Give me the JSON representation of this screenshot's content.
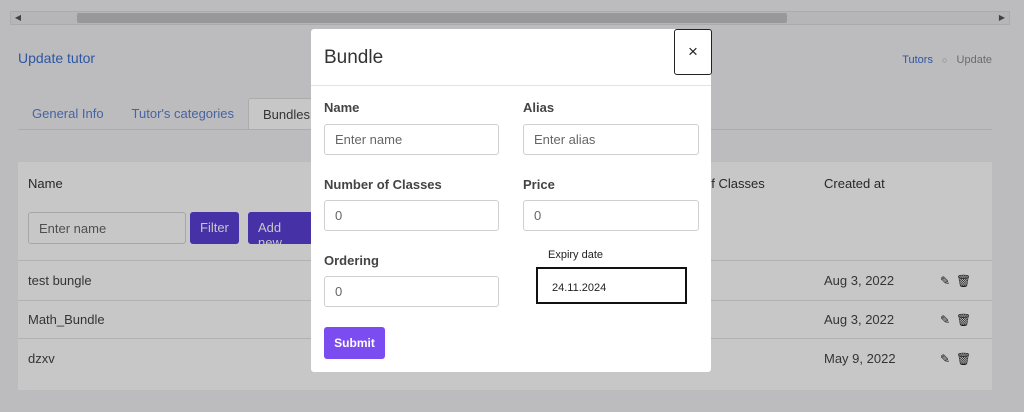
{
  "scrollbar": {
    "left_arrow": "◀",
    "right_arrow": "▶"
  },
  "page": {
    "title": "Update tutor",
    "breadcrumb": {
      "link": "Tutors",
      "separator": "○",
      "current": "Update"
    },
    "tabs": [
      "General Info",
      "Tutor's categories",
      "Bundles"
    ],
    "table": {
      "headers": {
        "name": "Name",
        "classes": "of Classes",
        "created": "Created at"
      },
      "filter_placeholder": "Enter name",
      "filter_label": "Filter",
      "add_new_label": "Add new",
      "rows": [
        {
          "name": "test bungle",
          "created": "Aug 3, 2022"
        },
        {
          "name": "Math_Bundle",
          "created": "Aug 3, 2022"
        },
        {
          "name": "dzxv",
          "created": "May 9, 2022"
        }
      ],
      "edit_icon": "pencil-icon",
      "delete_icon": "trash-icon"
    }
  },
  "modal": {
    "title": "Bundle",
    "close_label": "×",
    "fields": {
      "name": {
        "label": "Name",
        "placeholder": "Enter name"
      },
      "alias": {
        "label": "Alias",
        "placeholder": "Enter alias"
      },
      "classes": {
        "label": "Number of Classes",
        "value": "0"
      },
      "price": {
        "label": "Price",
        "value": "0"
      },
      "ordering": {
        "label": "Ordering",
        "value": "0"
      },
      "expiry": {
        "label": "Expiry date",
        "value": "24.11.2024"
      }
    },
    "submit_label": "Submit"
  }
}
